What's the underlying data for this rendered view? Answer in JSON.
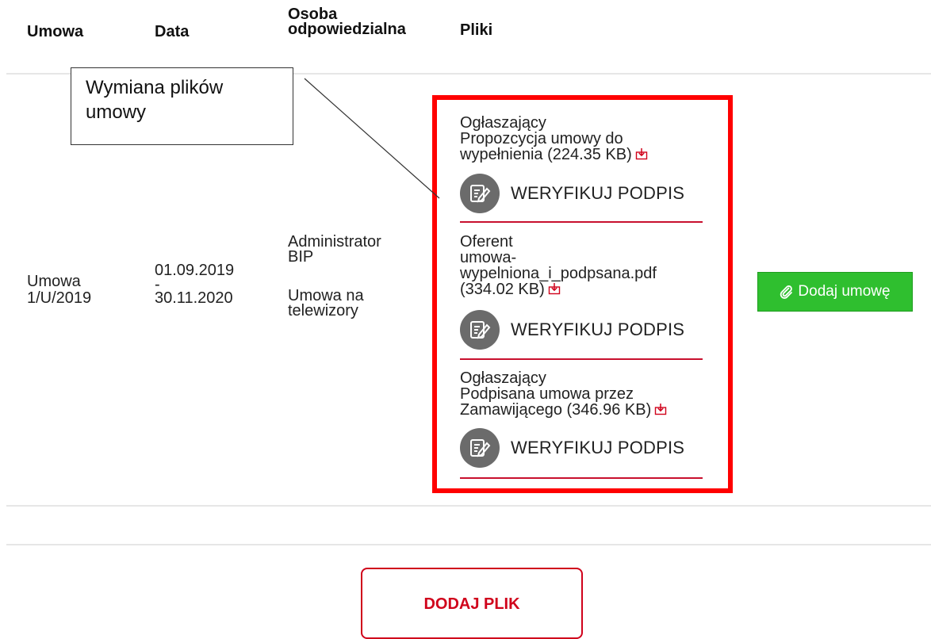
{
  "table": {
    "headers": {
      "contract": "Umowa",
      "date": "Data",
      "responsible_line1": "Osoba",
      "responsible_line2": "odpowiedzialna",
      "files": "Pliki"
    },
    "row": {
      "contract_line1": "Umowa",
      "contract_line2": "1/U/2019",
      "date_from": "01.09.2019",
      "date_separator": "-",
      "date_to": "30.11.2020",
      "responsible_line1": "Administrator",
      "responsible_line2": "BIP",
      "note_line1": "Umowa na",
      "note_line2": "telewizory"
    }
  },
  "files": [
    {
      "author": "Ogłaszający",
      "name_line1": "Propozcycja umowy do",
      "name_line2": "wypełnienia (224.35 KB)",
      "verify_label": "WERYFIKUJ PODPIS"
    },
    {
      "author": "Oferent",
      "name_line1": "umowa-",
      "name_line2": "wypelniona_i_podpsana.pdf",
      "name_line3": "(334.02 KB)",
      "verify_label": "WERYFIKUJ PODPIS"
    },
    {
      "author": "Ogłaszający",
      "name_line1": "Podpisana umowa przez",
      "name_line2": "Zamawijącego (346.96 KB)",
      "verify_label": "WERYFIKUJ PODPIS"
    }
  ],
  "add_contract_button": {
    "label": "Dodaj umowę",
    "color": "#2fbf2f"
  },
  "callout": {
    "line1": "Wymiana plików",
    "line2": "umowy"
  },
  "add_file_button": {
    "label": "DODAJ PLIK",
    "color": "#d0021b"
  },
  "icons": {
    "download": "download-icon",
    "verify": "signature-edit-icon",
    "paperclip": "paperclip-icon"
  },
  "colors": {
    "highlight_border": "#ff0000",
    "separator": "#c8102e"
  }
}
